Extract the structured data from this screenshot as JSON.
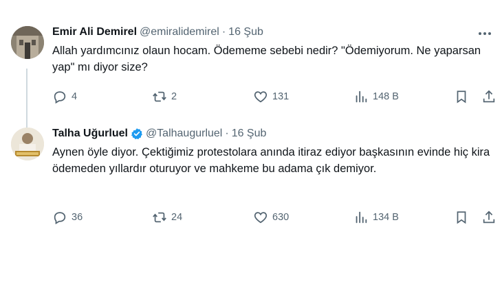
{
  "tweets": [
    {
      "name": "Emir Ali Demirel",
      "handle": "@emiralidemirel",
      "separator": "·",
      "date": "16 Şub",
      "text": "Allah yardımcınız olaun hocam. Ödememe sebebi nedir? \"Ödemiyorum. Ne yaparsan yap\" mı diyor size?",
      "replies": "4",
      "retweets": "2",
      "likes": "131",
      "views": "148 B"
    },
    {
      "name": "Talha Uğurluel",
      "handle": "@Talhaugurluel",
      "separator": "·",
      "date": "16 Şub",
      "text": "Aynen öyle diyor. Çektiğimiz protestolara anında itiraz ediyor başkasının evinde hiç kira ödemeden yıllardır oturuyor ve mahkeme bu adama çık demiyor.",
      "replies": "36",
      "retweets": "24",
      "likes": "630",
      "views": "134 B"
    }
  ],
  "colors": {
    "text": "#0f1419",
    "muted": "#536471",
    "verified": "#1d9bf0",
    "thread": "#cfd9de"
  }
}
